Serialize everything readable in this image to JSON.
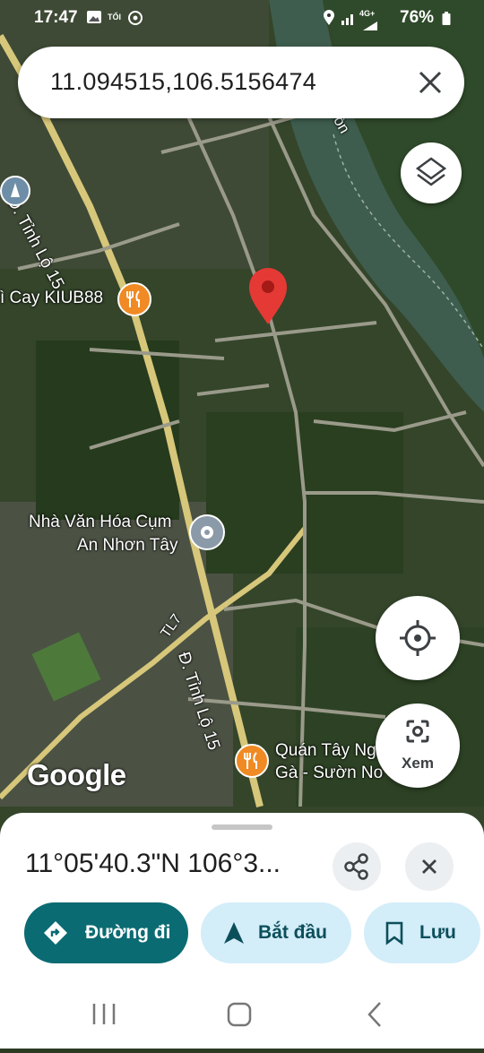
{
  "status_bar": {
    "time": "17:47",
    "network": "4G+",
    "battery": "76%"
  },
  "search": {
    "query": "11.094515,106.5156474"
  },
  "map": {
    "road_label_1": "Đ. Tỉnh Lộ 15",
    "road_label_2": "Đ. Tỉnh Lộ 15",
    "road_label_3": "TL7",
    "river_label": "i Gòn",
    "place_1": "Nhà Văn Hóa Cụm",
    "place_1b": "An Nhơn Tây",
    "place_2": "ì Cay KIUB88",
    "place_3": "Quán Tây Ng",
    "place_3b": "Gà - Sườn No",
    "google_logo": "Google",
    "lens_label": "Xem"
  },
  "sheet": {
    "coordinates": "11°05'40.3\"N 106°3...",
    "directions_label": "Đường đi",
    "start_label": "Bắt đầu",
    "save_label": "Lưu"
  },
  "colors": {
    "teal": "#0b6b72",
    "light_blue": "#d3edf9",
    "pin_red": "#e53935",
    "poi_orange": "#f08a24"
  }
}
